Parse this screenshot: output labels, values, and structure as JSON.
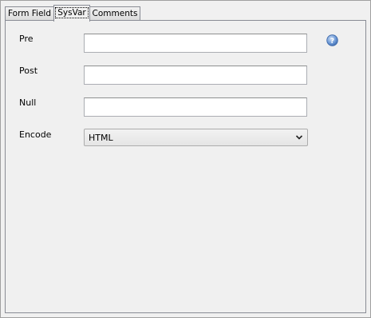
{
  "tabs": [
    {
      "label": "Form Field",
      "active": false
    },
    {
      "label": "SysVar",
      "active": true
    },
    {
      "label": "Comments",
      "active": false
    }
  ],
  "form": {
    "pre": {
      "label": "Pre",
      "value": ""
    },
    "post": {
      "label": "Post",
      "value": ""
    },
    "null": {
      "label": "Null",
      "value": ""
    },
    "encode": {
      "label": "Encode",
      "selected": "HTML"
    }
  },
  "icons": {
    "help": "help-icon",
    "dropdown": "chevron-down-icon"
  },
  "colors": {
    "help_icon": "#4a7fc4",
    "panel_bg": "#f0f0f0",
    "border": "#898c95"
  }
}
